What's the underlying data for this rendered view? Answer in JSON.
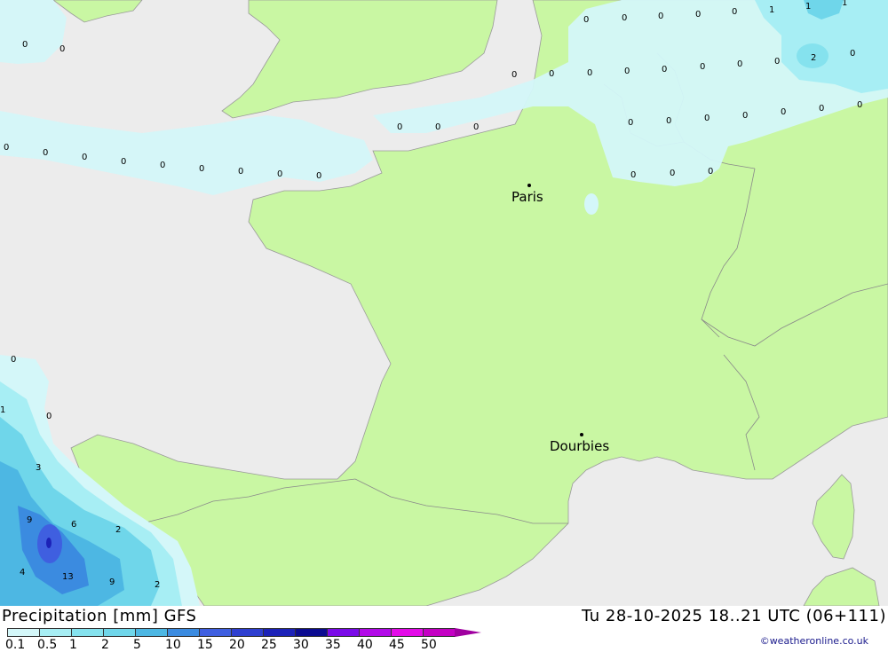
{
  "map": {
    "colors": {
      "sea": "#ececec",
      "land": "#c9f7a3",
      "precip_light": "#d4f7f9",
      "precip_0_5": "#a7eef4",
      "precip_2": "#6fd6ea",
      "precip_5": "#4db7e3",
      "precip_10": "#3b8be0",
      "precip_15": "#3f5fe0"
    },
    "cities": [
      {
        "name": "Paris"
      },
      {
        "name": "Dourbies"
      }
    ],
    "values": [
      "0",
      "0",
      "0",
      "0",
      "0",
      "0",
      "0",
      "0",
      "0",
      "0",
      "0",
      "0",
      "0",
      "0",
      "0",
      "0",
      "0",
      "0",
      "0",
      "0",
      "0",
      "0",
      "0",
      "0",
      "0",
      "0",
      "0",
      "0",
      "0",
      "0",
      "0",
      "0",
      "0",
      "0",
      "0",
      "0",
      "0",
      "0",
      "0",
      "0",
      "0",
      "0",
      "0",
      "0",
      "0",
      "1",
      "1",
      "1",
      "2",
      "0",
      "0",
      "1",
      "0",
      "3",
      "9",
      "6",
      "2",
      "4",
      "13",
      "9",
      "2"
    ]
  },
  "footer": {
    "title": "Precipitation [mm] GFS",
    "datetime": "Tu 28-10-2025 18..21 UTC (06+111)",
    "credit": "©weatheronline.co.uk",
    "scale_labels": [
      "0.1",
      "0.5",
      "1",
      "2",
      "5",
      "10",
      "15",
      "20",
      "25",
      "30",
      "35",
      "40",
      "45",
      "50"
    ],
    "scale_colors": [
      "#d4f7f9",
      "#a7eef4",
      "#85e2ee",
      "#6fd6ea",
      "#4db7e3",
      "#3b8be0",
      "#3f5fe0",
      "#2e3fd0",
      "#1c22b8",
      "#0b0b90",
      "#7a0ae8",
      "#b20ae8",
      "#e30ae8",
      "#c400c4",
      "#a000a0"
    ]
  }
}
